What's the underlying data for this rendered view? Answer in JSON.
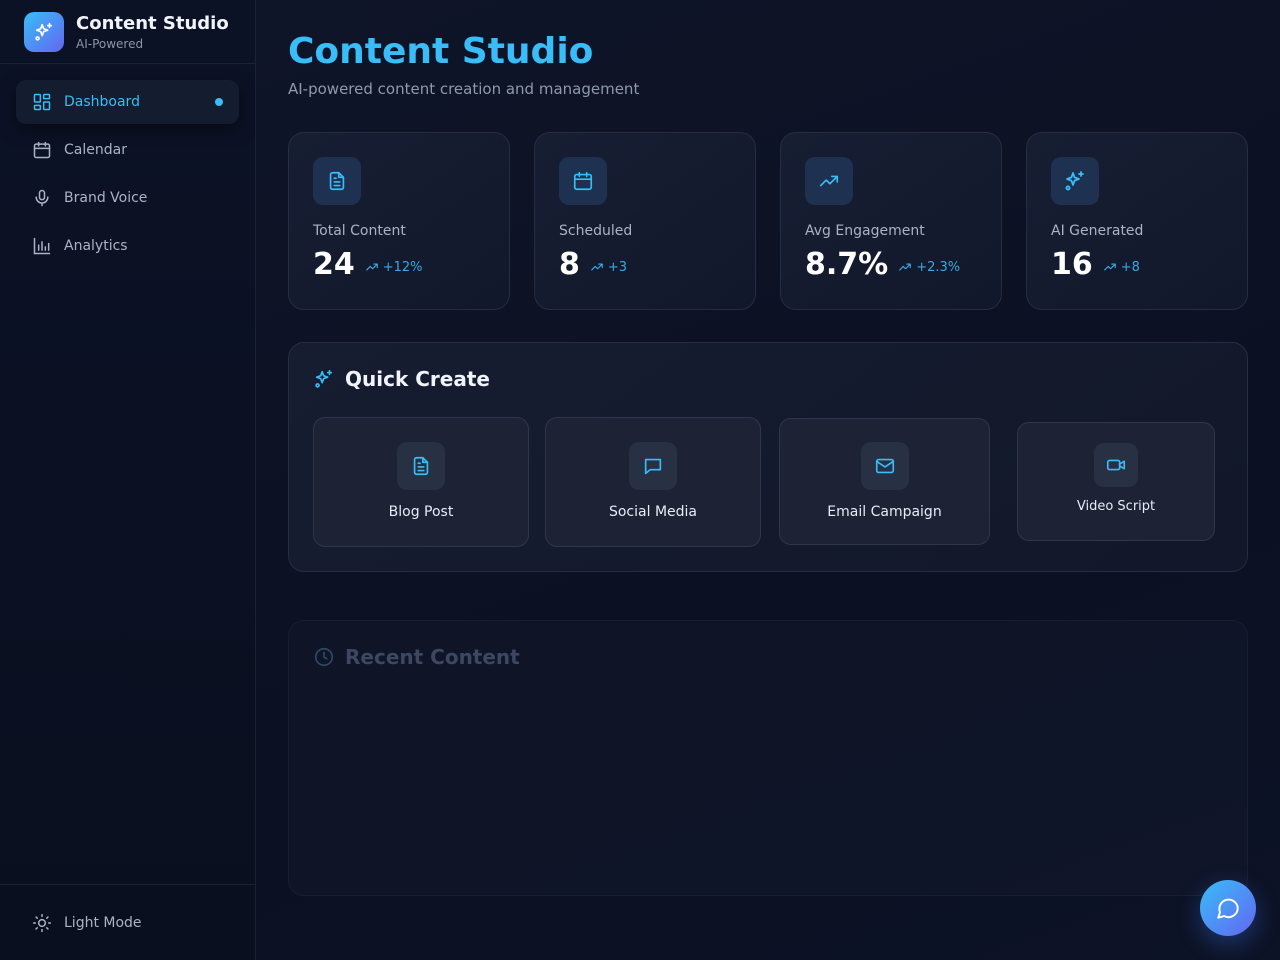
{
  "brand": {
    "title": "Content Studio",
    "subtitle": "AI-Powered"
  },
  "nav": {
    "items": [
      {
        "label": "Dashboard",
        "icon": "dashboard-icon",
        "active": true
      },
      {
        "label": "Calendar",
        "icon": "calendar-icon"
      },
      {
        "label": "Brand Voice",
        "icon": "microphone-icon"
      },
      {
        "label": "Analytics",
        "icon": "bar-chart-icon"
      }
    ],
    "footer_label": "Light Mode"
  },
  "header": {
    "title": "Content Studio",
    "subtitle": "AI-powered content creation and management"
  },
  "stats": [
    {
      "label": "Total Content",
      "value": "24",
      "trend": "+12%",
      "icon": "document-icon"
    },
    {
      "label": "Scheduled",
      "value": "8",
      "trend": "+3",
      "icon": "calendar-icon"
    },
    {
      "label": "Avg Engagement",
      "value": "8.7%",
      "trend": "+2.3%",
      "icon": "trending-up-icon"
    },
    {
      "label": "AI Generated",
      "value": "16",
      "trend": "+8",
      "icon": "sparkles-icon"
    }
  ],
  "quick_create": {
    "title": "Quick Create",
    "items": [
      {
        "label": "Blog Post",
        "icon": "document-icon"
      },
      {
        "label": "Social Media",
        "icon": "chat-bubble-icon"
      },
      {
        "label": "Email Campaign",
        "icon": "mail-icon"
      },
      {
        "label": "Video Script",
        "icon": "video-icon"
      }
    ]
  },
  "recent": {
    "title": "Recent Content"
  },
  "colors": {
    "accent": "#38bdf8",
    "accent_secondary": "#6366f1",
    "background": "#0b1020"
  }
}
